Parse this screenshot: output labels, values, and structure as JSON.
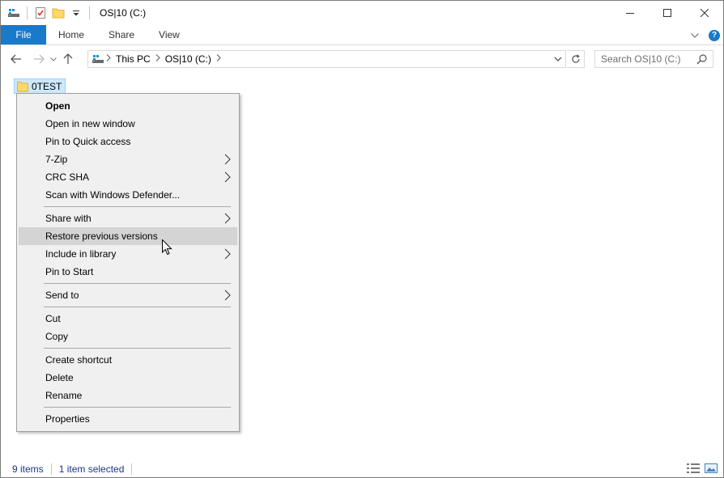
{
  "window": {
    "title": "OS|10 (C:)",
    "controls": {
      "minimize": "─",
      "maximize": "☐",
      "close": "✕"
    }
  },
  "ribbon": {
    "tabs": [
      {
        "label": "File",
        "active": true
      },
      {
        "label": "Home"
      },
      {
        "label": "Share"
      },
      {
        "label": "View"
      }
    ],
    "help_glyph": "?"
  },
  "navigation": {
    "breadcrumb": [
      "This PC",
      "OS|10 (C:)"
    ],
    "search_placeholder": "Search OS|10 (C:)"
  },
  "content": {
    "selected_item": {
      "name": "0TEST",
      "icon": "folder-icon"
    }
  },
  "context_menu": {
    "groups": [
      [
        {
          "label": "Open",
          "bold": true
        },
        {
          "label": "Open in new window"
        },
        {
          "label": "Pin to Quick access"
        },
        {
          "label": "7-Zip",
          "submenu": true
        },
        {
          "label": "CRC SHA",
          "submenu": true
        },
        {
          "label": "Scan with Windows Defender..."
        }
      ],
      [
        {
          "label": "Share with",
          "submenu": true
        },
        {
          "label": "Restore previous versions",
          "highlighted": true
        },
        {
          "label": "Include in library",
          "submenu": true
        },
        {
          "label": "Pin to Start"
        }
      ],
      [
        {
          "label": "Send to",
          "submenu": true
        }
      ],
      [
        {
          "label": "Cut"
        },
        {
          "label": "Copy"
        }
      ],
      [
        {
          "label": "Create shortcut"
        },
        {
          "label": "Delete"
        },
        {
          "label": "Rename"
        }
      ],
      [
        {
          "label": "Properties"
        }
      ]
    ]
  },
  "status": {
    "item_count": "9 items",
    "selection": "1 item selected"
  },
  "colors": {
    "accent": "#1979ca",
    "selection_bg": "#cce8ff",
    "menu_bg": "#f0f0f0",
    "menu_highlight": "#d4d4d4",
    "status_text": "#1e3287"
  }
}
